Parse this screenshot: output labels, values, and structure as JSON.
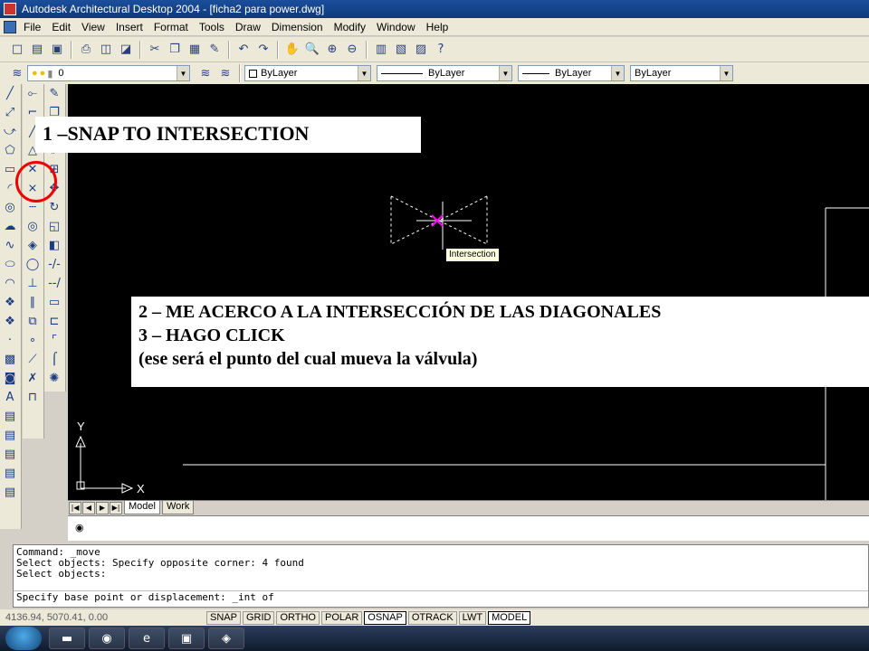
{
  "window": {
    "title": "Autodesk Architectural Desktop 2004 - [ficha2 para power.dwg]"
  },
  "menu": [
    "File",
    "Edit",
    "View",
    "Insert",
    "Format",
    "Tools",
    "Draw",
    "Dimension",
    "Modify",
    "Window",
    "Help"
  ],
  "layer_toolbar": {
    "layer_value": "0",
    "color_value": "ByLayer",
    "linetype_value": "ByLayer",
    "lineweight_value": "ByLayer",
    "plotstyle_value": "ByLayer"
  },
  "canvas": {
    "ucs_y_label": "Y",
    "ucs_x_label": "X",
    "tooltip": "Intersection"
  },
  "layout_tabs": {
    "model": "Model",
    "work": "Work"
  },
  "command_history": [
    "Command: _move",
    "Select objects: Specify opposite corner: 4 found",
    "Select objects:"
  ],
  "command_prompt": "Specify base point or displacement: _int of",
  "status": {
    "coords": "4136.94, 5070.41, 0.00",
    "toggles": [
      {
        "label": "SNAP",
        "on": false
      },
      {
        "label": "GRID",
        "on": false
      },
      {
        "label": "ORTHO",
        "on": false
      },
      {
        "label": "POLAR",
        "on": false
      },
      {
        "label": "OSNAP",
        "on": true
      },
      {
        "label": "OTRACK",
        "on": false
      },
      {
        "label": "LWT",
        "on": false
      },
      {
        "label": "MODEL",
        "on": true
      }
    ]
  },
  "annotations": {
    "step1": "1 –SNAP  TO INTERSECTION",
    "step2": "2 – ME ACERCO A LA INTERSECCIÓN DE LAS DIAGONALES",
    "step3": "3 – HAGO CLICK",
    "step3_note": "(ese será el punto del cual mueva la válvula)"
  },
  "colors": {
    "canvas": "#000000",
    "highlight_circle": "#e00000",
    "snap_marker": "#ff00ff"
  }
}
